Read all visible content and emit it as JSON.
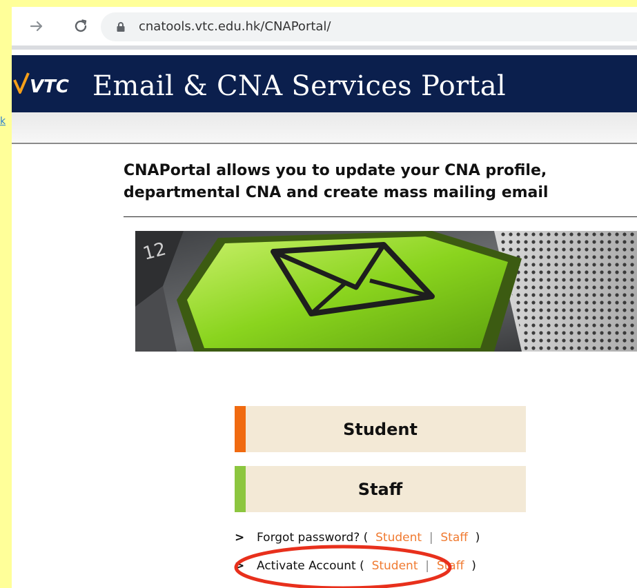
{
  "slide": {
    "left_link_text": "k"
  },
  "browser": {
    "url": "cnatools.vtc.edu.hk/CNAPortal/"
  },
  "header": {
    "logo_text": "VTC",
    "title": "Email & CNA Services Portal"
  },
  "intro": {
    "line1": "CNAPortal allows you to update your CNA profile,",
    "line2": "departmental CNA and create mass mailing email"
  },
  "portal_buttons": {
    "student": "Student",
    "staff": "Staff"
  },
  "links": {
    "forgot": {
      "label": "Forgot password?",
      "student": "Student",
      "staff": "Staff"
    },
    "activate": {
      "label": "Activate Account",
      "student": "Student",
      "staff": "Staff"
    }
  },
  "colors": {
    "header_bg": "#0b1f4d",
    "student_accent": "#f06a10",
    "staff_accent": "#8cc63f",
    "link": "#f07a30",
    "highlight": "#e8301c",
    "slide_bg": "#ffff99"
  }
}
